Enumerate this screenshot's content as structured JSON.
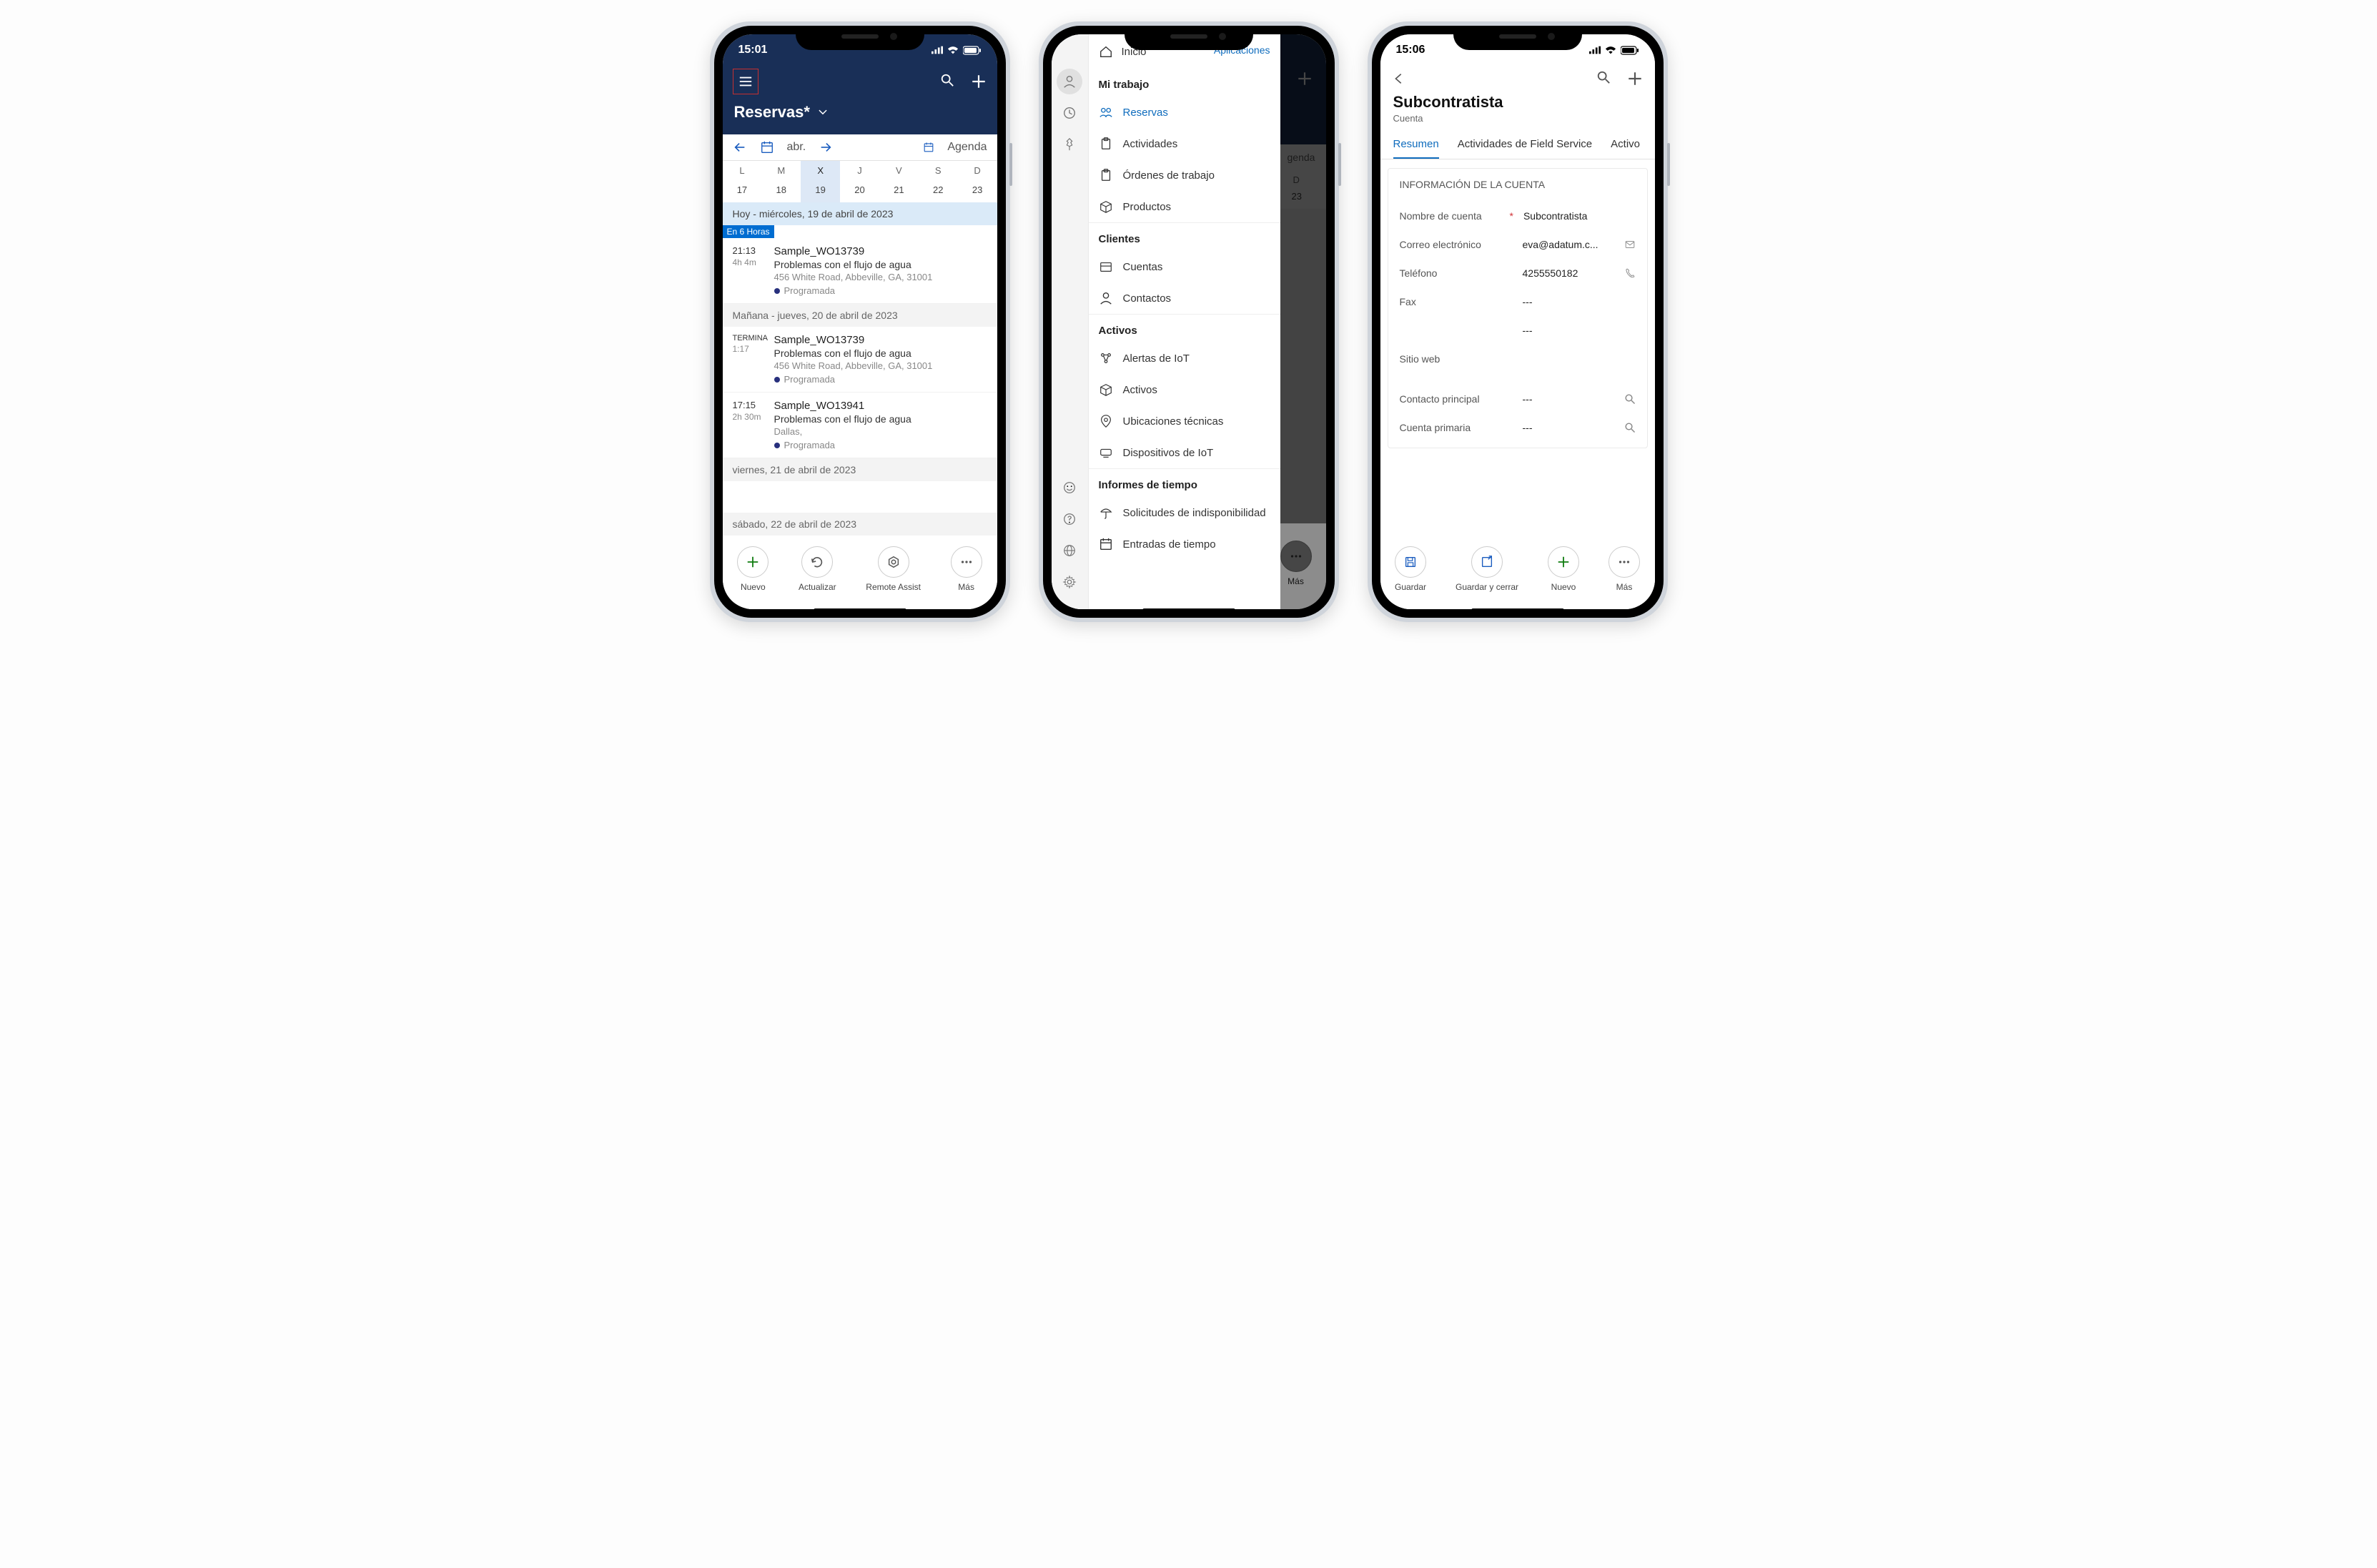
{
  "screen1": {
    "status": {
      "time": "15:01"
    },
    "title": "Reservas*",
    "month": "abr.",
    "agenda_label": "Agenda",
    "weekdays": [
      "L",
      "M",
      "X",
      "J",
      "V",
      "S",
      "D"
    ],
    "dates": [
      "17",
      "18",
      "19",
      "20",
      "21",
      "22",
      "23"
    ],
    "today_header": "Hoy - miércoles, 19 de abril de 2023",
    "badge_in": "En 6 Horas",
    "bookings": [
      {
        "time": "21:13",
        "dur": "4h 4m",
        "title": "Sample_WO13739",
        "sub": "Problemas con el flujo de agua",
        "addr": "456 White Road, Abbeville, GA, 31001",
        "status": "Programada"
      }
    ],
    "tomorrow_header": "Mañana - jueves, 20 de abril de 2023",
    "tomorrow_bookings": [
      {
        "time": "TERMINA",
        "dur": "1:17",
        "title": "Sample_WO13739",
        "sub": "Problemas con el flujo de agua",
        "addr": "456 White Road, Abbeville, GA, 31001",
        "status": "Programada"
      },
      {
        "time": "17:15",
        "dur": "2h 30m",
        "title": "Sample_WO13941",
        "sub": "Problemas con el flujo de agua",
        "addr": "Dallas,",
        "status": "Programada"
      }
    ],
    "friday_header": "viernes, 21 de abril de 2023",
    "saturday_header": "sábado, 22 de abril de 2023",
    "actions": {
      "new": "Nuevo",
      "refresh": "Actualizar",
      "remote": "Remote Assist",
      "more": "Más"
    }
  },
  "screen2": {
    "home_label": "Inicio",
    "apps_label": "Aplicaciones",
    "behind_agenda": "genda",
    "behind_day": "D",
    "behind_date": "23",
    "behind_more": "Más",
    "groups": [
      {
        "title": "Mi trabajo",
        "items": [
          {
            "label": "Reservas",
            "selected": true,
            "icon": "people"
          },
          {
            "label": "Actividades",
            "icon": "clipboard"
          },
          {
            "label": "Órdenes de trabajo",
            "icon": "clipboard"
          },
          {
            "label": "Productos",
            "icon": "box"
          }
        ]
      },
      {
        "title": "Clientes",
        "items": [
          {
            "label": "Cuentas",
            "icon": "account"
          },
          {
            "label": "Contactos",
            "icon": "person"
          }
        ]
      },
      {
        "title": "Activos",
        "items": [
          {
            "label": "Alertas de IoT",
            "icon": "iot"
          },
          {
            "label": "Activos",
            "icon": "box"
          },
          {
            "label": "Ubicaciones técnicas",
            "icon": "pin"
          },
          {
            "label": "Dispositivos de IoT",
            "icon": "device"
          }
        ]
      },
      {
        "title": "Informes de tiempo",
        "items": [
          {
            "label": "Solicitudes de indisponibilidad",
            "icon": "umbrella"
          },
          {
            "label": "Entradas de tiempo",
            "icon": "calendar"
          }
        ]
      }
    ]
  },
  "screen3": {
    "status": {
      "time": "15:06"
    },
    "title": "Subcontratista",
    "subtitle": "Cuenta",
    "tabs": {
      "summary": "Resumen",
      "fs": "Actividades de Field Service",
      "assets": "Activo"
    },
    "card_title": "INFORMACIÓN DE LA CUENTA",
    "fields": {
      "name_label": "Nombre de cuenta",
      "name_value": "Subcontratista",
      "email_label": "Correo electrónico",
      "email_value": "eva@adatum.c...",
      "phone_label": "Teléfono",
      "phone_value": "4255550182",
      "fax_label": "Fax",
      "fax_value": "---",
      "blank_value": "---",
      "site_label": "Sitio web",
      "contact_label": "Contacto principal",
      "contact_value": "---",
      "primary_label": "Cuenta primaria",
      "primary_value": "---"
    },
    "actions": {
      "save": "Guardar",
      "saveclose": "Guardar y cerrar",
      "new": "Nuevo",
      "more": "Más"
    }
  }
}
